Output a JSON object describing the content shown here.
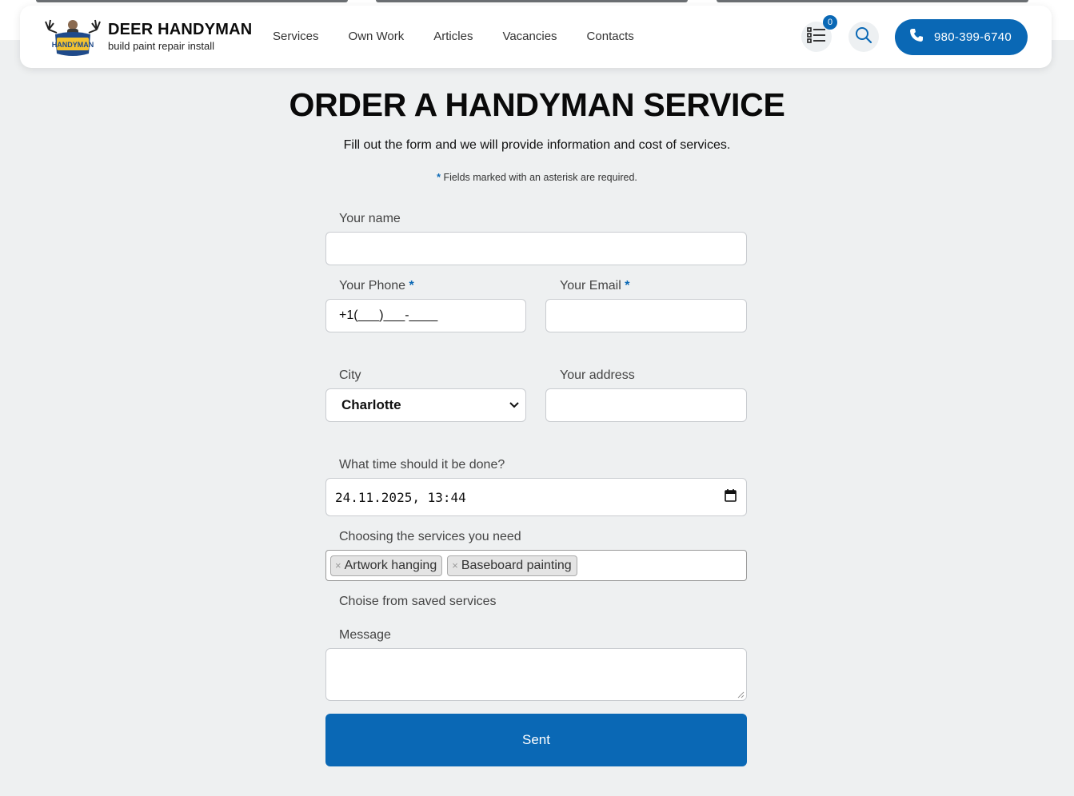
{
  "brand": {
    "title": "DEER HANDYMAN",
    "tagline": "build paint repair install",
    "logo_text": "HANDYMAN"
  },
  "nav": {
    "items": [
      "Services",
      "Own Work",
      "Articles",
      "Vacancies",
      "Contacts"
    ]
  },
  "header": {
    "list_icon": "list-icon",
    "saved_count": "0",
    "search_icon": "search-icon",
    "phone_icon": "phone-icon",
    "phone_number": "980-399-6740"
  },
  "page": {
    "title": "ORDER A HANDYMAN SERVICE",
    "subtitle": "Fill out the form and we will provide information and cost of services.",
    "required_note_star": "*",
    "required_note": "Fields marked with an asterisk are required."
  },
  "form": {
    "name_label": "Your name",
    "name_value": "",
    "phone_label": "Your Phone",
    "phone_value": "+1(___)___-____",
    "email_label": "Your Email",
    "email_value": "",
    "required_star": "*",
    "city_label": "City",
    "city_value": "Charlotte",
    "address_label": "Your address",
    "address_value": "",
    "time_label": "What time should it be done?",
    "time_value": "24.11.2025, 13:44",
    "services_label": "Choosing the services you need",
    "selected_services": [
      "Artwork hanging",
      "Baseboard painting"
    ],
    "remove_symbol": "×",
    "saved_services_label": "Choise from saved services",
    "message_label": "Message",
    "message_value": "",
    "submit_label": "Sent"
  },
  "colors": {
    "accent": "#0a68b5",
    "background": "#eef0f1"
  }
}
